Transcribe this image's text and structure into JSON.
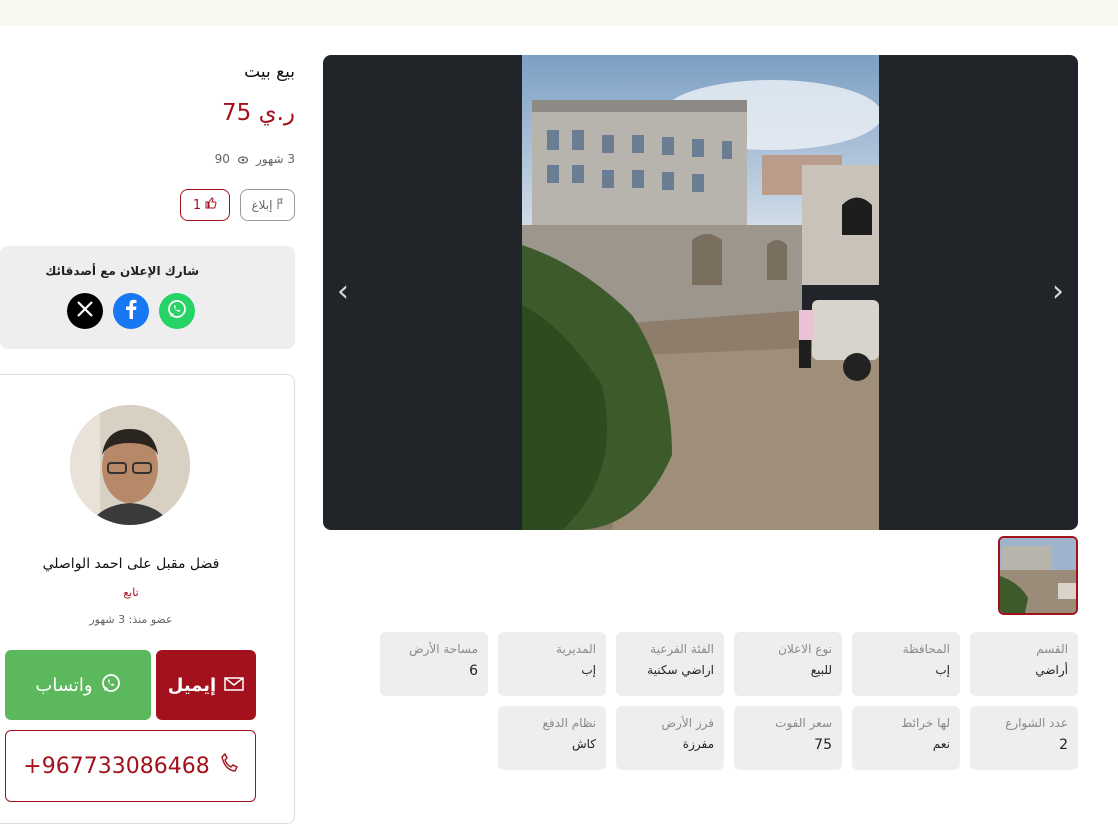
{
  "listing": {
    "title": "بيع بيت",
    "price": "75 ر.ي",
    "posted_ago": "3 شهور",
    "views": "90",
    "report_label": "إبلاغ",
    "likes": "1"
  },
  "share": {
    "title": "شارك الإعلان مع أصدقائك",
    "networks": [
      "x-icon",
      "facebook-icon",
      "whatsapp-icon"
    ]
  },
  "seller": {
    "name": "فضل مقبل على احمد الواصلي",
    "follow_label": "تابع",
    "member_since": "عضو منذ: 3 شهور",
    "whatsapp_label": "واتساب",
    "email_label": "إيميل",
    "phone": "+967733086468"
  },
  "attributes": [
    {
      "label": "القسم",
      "value": "أراضي"
    },
    {
      "label": "المحافظة",
      "value": "إب"
    },
    {
      "label": "نوع الاعلان",
      "value": "للبيع"
    },
    {
      "label": "الفئة الفرعية",
      "value": "اراضي سكنية"
    },
    {
      "label": "المديرية",
      "value": "إب"
    },
    {
      "label": "مساحة الأرض",
      "value": "6"
    },
    {
      "label": "عدد الشوارع",
      "value": "2"
    },
    {
      "label": "لها خرائط",
      "value": "نعم"
    },
    {
      "label": "سعر الفوت",
      "value": "75"
    },
    {
      "label": "فرز الأرض",
      "value": "مفرزة"
    },
    {
      "label": "نظام الدفع",
      "value": "كاش"
    }
  ],
  "colors": {
    "brand": "#a3111c",
    "whatsapp": "#5cb85c",
    "gallery_bg": "#212529",
    "card_bg": "#eeeeee"
  }
}
